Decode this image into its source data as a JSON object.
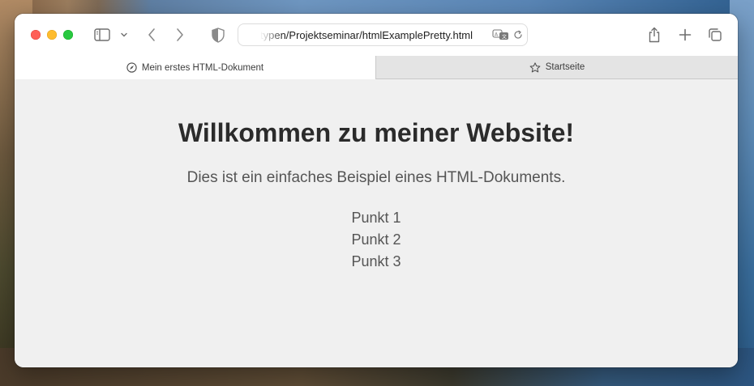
{
  "browser": {
    "address_bar": {
      "url_display": "typen/Projektseminar/htmlExamplePretty.html"
    },
    "tabs": [
      {
        "title": "Mein erstes HTML-Dokument",
        "icon": "compass-icon",
        "active": true
      },
      {
        "title": "Startseite",
        "icon": "star-icon",
        "active": false
      }
    ],
    "toolbar_icons": [
      "sidebar-icon",
      "chevron-down-icon",
      "back-icon",
      "forward-icon",
      "shield-icon",
      "translate-icon",
      "reload-icon",
      "share-icon",
      "plus-icon",
      "tab-overview-icon"
    ]
  },
  "page": {
    "heading": "Willkommen zu meiner Website!",
    "intro": "Dies ist ein einfaches Beispiel eines HTML-Dokuments.",
    "list": [
      "Punkt 1",
      "Punkt 2",
      "Punkt 3"
    ]
  },
  "colors": {
    "close": "#fe5f57",
    "minimize": "#febc2e",
    "maximize": "#28c840",
    "page_background": "#f0f0f0",
    "heading_text": "#2b2b2b",
    "body_text": "#555555"
  }
}
